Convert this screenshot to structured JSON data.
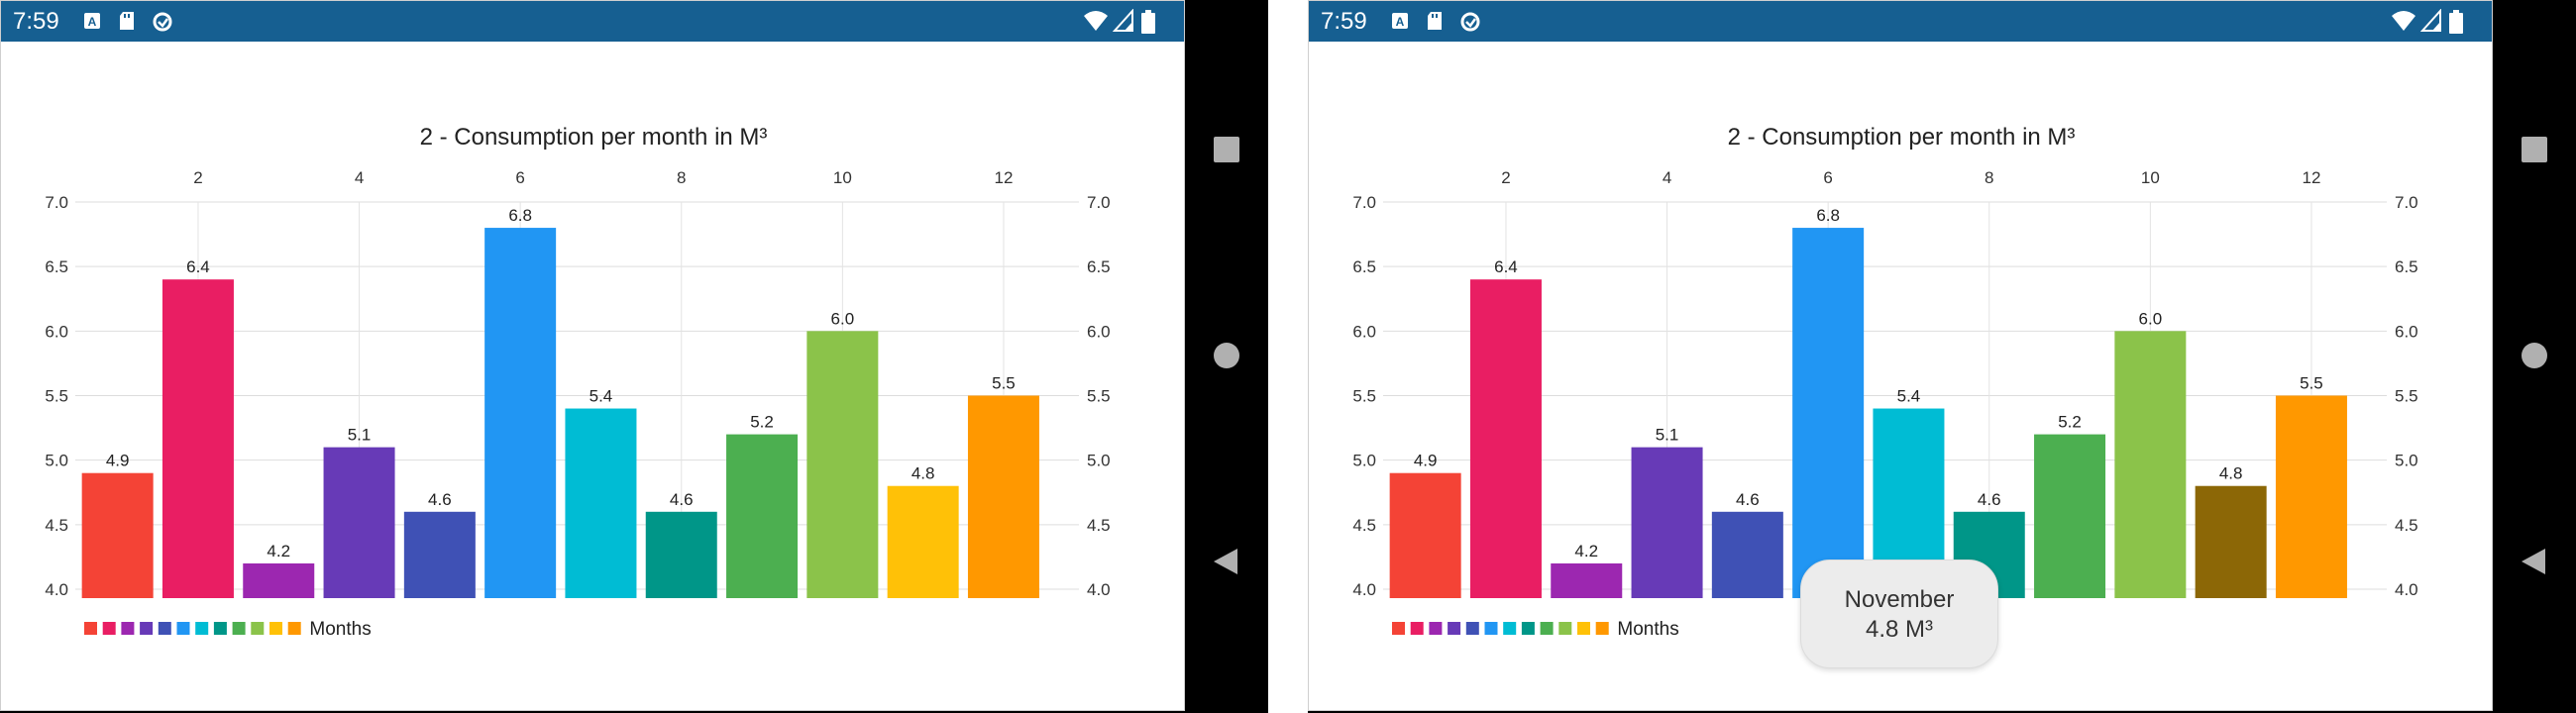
{
  "status_bar": {
    "time": "7:59",
    "icons": [
      "a-badge-icon",
      "sd-card-icon",
      "sync-icon",
      "wifi-icon",
      "signal-icon",
      "battery-icon"
    ]
  },
  "nav_bar": {
    "buttons": [
      "recents-square-icon",
      "home-circle-icon",
      "back-triangle-icon"
    ]
  },
  "tooltip": {
    "month": "November",
    "value": "4.8 M³"
  },
  "chart_data": [
    {
      "type": "bar",
      "title": "2 - Consumption per month in M³",
      "x": [
        1,
        2,
        3,
        4,
        5,
        6,
        7,
        8,
        9,
        10,
        11,
        12
      ],
      "values": [
        4.9,
        6.4,
        4.2,
        5.1,
        4.6,
        6.8,
        5.4,
        4.6,
        5.2,
        6.0,
        4.8,
        5.5
      ],
      "data_labels": [
        "4.9",
        "6.4",
        "4.2",
        "5.1",
        "4.6",
        "6.8",
        "5.4",
        "4.6",
        "5.2",
        "6.0",
        "4.8",
        "5.5"
      ],
      "colors": [
        "#f44336",
        "#e91e63",
        "#9c27b0",
        "#673ab7",
        "#3f51b5",
        "#2196f3",
        "#00bcd4",
        "#009688",
        "#4caf50",
        "#8bc34a",
        "#ffc107",
        "#ff9800"
      ],
      "x_ticks": [
        "2",
        "4",
        "6",
        "8",
        "10",
        "12"
      ],
      "x_tick_values": [
        2,
        4,
        6,
        8,
        10,
        12
      ],
      "y_ticks": [
        "4.0",
        "4.5",
        "5.0",
        "5.5",
        "6.0",
        "6.5",
        "7.0"
      ],
      "y_tick_values": [
        4.0,
        4.5,
        5.0,
        5.5,
        6.0,
        6.5,
        7.0
      ],
      "ylim": [
        4.0,
        7.0
      ],
      "legend": {
        "label": "Months",
        "position": "bottom-left"
      },
      "grid": true
    },
    {
      "type": "bar",
      "title": "2 - Consumption per month in M³",
      "x": [
        1,
        2,
        3,
        4,
        5,
        6,
        7,
        8,
        9,
        10,
        11,
        12
      ],
      "values": [
        4.9,
        6.4,
        4.2,
        5.1,
        4.6,
        6.8,
        5.4,
        4.6,
        5.2,
        6.0,
        4.8,
        5.5
      ],
      "data_labels": [
        "4.9",
        "6.4",
        "4.2",
        "5.1",
        "4.6",
        "6.8",
        "5.4",
        "4.6",
        "5.2",
        "6.0",
        "4.8",
        "5.5"
      ],
      "colors": [
        "#f44336",
        "#e91e63",
        "#9c27b0",
        "#673ab7",
        "#3f51b5",
        "#2196f3",
        "#00bcd4",
        "#009688",
        "#4caf50",
        "#8bc34a",
        "#8c6706",
        "#ff9800"
      ],
      "legend_colors": [
        "#f44336",
        "#e91e63",
        "#9c27b0",
        "#673ab7",
        "#3f51b5",
        "#2196f3",
        "#00bcd4",
        "#009688",
        "#4caf50",
        "#8bc34a",
        "#ffc107",
        "#ff9800"
      ],
      "highlighted_index": 10,
      "x_ticks": [
        "2",
        "4",
        "6",
        "8",
        "10",
        "12"
      ],
      "x_tick_values": [
        2,
        4,
        6,
        8,
        10,
        12
      ],
      "y_ticks": [
        "4.0",
        "4.5",
        "5.0",
        "5.5",
        "6.0",
        "6.5",
        "7.0"
      ],
      "y_tick_values": [
        4.0,
        4.5,
        5.0,
        5.5,
        6.0,
        6.5,
        7.0
      ],
      "ylim": [
        4.0,
        7.0
      ],
      "legend": {
        "label": "Months",
        "position": "bottom-left"
      },
      "grid": true
    }
  ]
}
